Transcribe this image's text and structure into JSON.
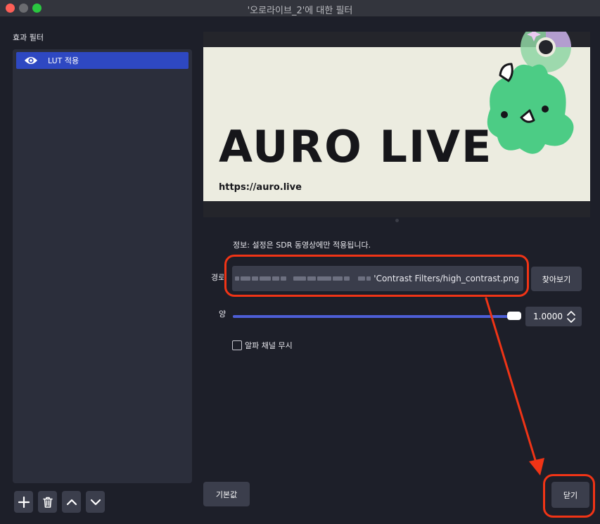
{
  "window": {
    "title": "'오로라이브_2'에 대한 필터"
  },
  "filters_panel": {
    "heading": "효과 필터",
    "items": [
      {
        "label": "LUT 적용",
        "icon": "eye-icon",
        "selected": true
      }
    ],
    "toolbar": [
      {
        "name": "add-filter-button",
        "icon": "plus-icon"
      },
      {
        "name": "remove-filter-button",
        "icon": "trash-icon"
      },
      {
        "name": "move-up-button",
        "icon": "chevron-up-icon"
      },
      {
        "name": "move-down-button",
        "icon": "chevron-down-icon"
      }
    ]
  },
  "preview": {
    "logo_text": "AURO LIVE",
    "url_text": "https://auro.live"
  },
  "settings": {
    "info": "정보: 설정은 SDR 동영상에만 적용됩니다.",
    "path_label": "경로",
    "path_value": "'Contrast Filters/high_contrast.png",
    "browse_label": "찾아보기",
    "amount_label": "양",
    "amount_value": "1.0000",
    "amount_fraction": 1.0,
    "ignore_alpha_label": "알파 채널 무시",
    "ignore_alpha_checked": false
  },
  "footer": {
    "defaults_label": "기본값",
    "close_label": "닫기"
  },
  "colors": {
    "accent": "#2e48c2",
    "slider": "#4d5ed6",
    "annotation": "#f03416",
    "mascot": "#4ccc85"
  }
}
